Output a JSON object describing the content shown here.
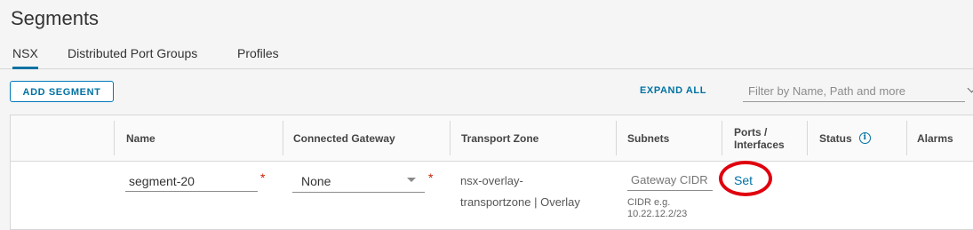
{
  "page": {
    "title": "Segments"
  },
  "tabs": [
    {
      "label": "NSX",
      "active": true
    },
    {
      "label": "Distributed Port Groups",
      "active": false
    },
    {
      "label": "Profiles",
      "active": false
    }
  ],
  "toolbar": {
    "add_label": "ADD SEGMENT",
    "expand_label": "EXPAND ALL",
    "filter_placeholder": "Filter by Name, Path and more"
  },
  "table": {
    "columns": [
      "Name",
      "Connected Gateway",
      "Transport Zone",
      "Subnets",
      "Ports / Interfaces",
      "Status",
      "Alarms"
    ],
    "row": {
      "name_value": "segment-20",
      "gateway_value": "None",
      "transport_zone_line1": "nsx-overlay-",
      "transport_zone_line2": "transportzone | Overlay",
      "subnet_placeholder": "Gateway CIDR",
      "subnet_hint_line1": "CIDR e.g.",
      "subnet_hint_line2": "10.22.12.2/23",
      "ports_link": "Set"
    }
  },
  "colors": {
    "accent": "#0072a3",
    "required": "#c92100",
    "highlight": "#e0000e"
  },
  "icons": [
    "info-icon",
    "chevron-down-icon"
  ]
}
